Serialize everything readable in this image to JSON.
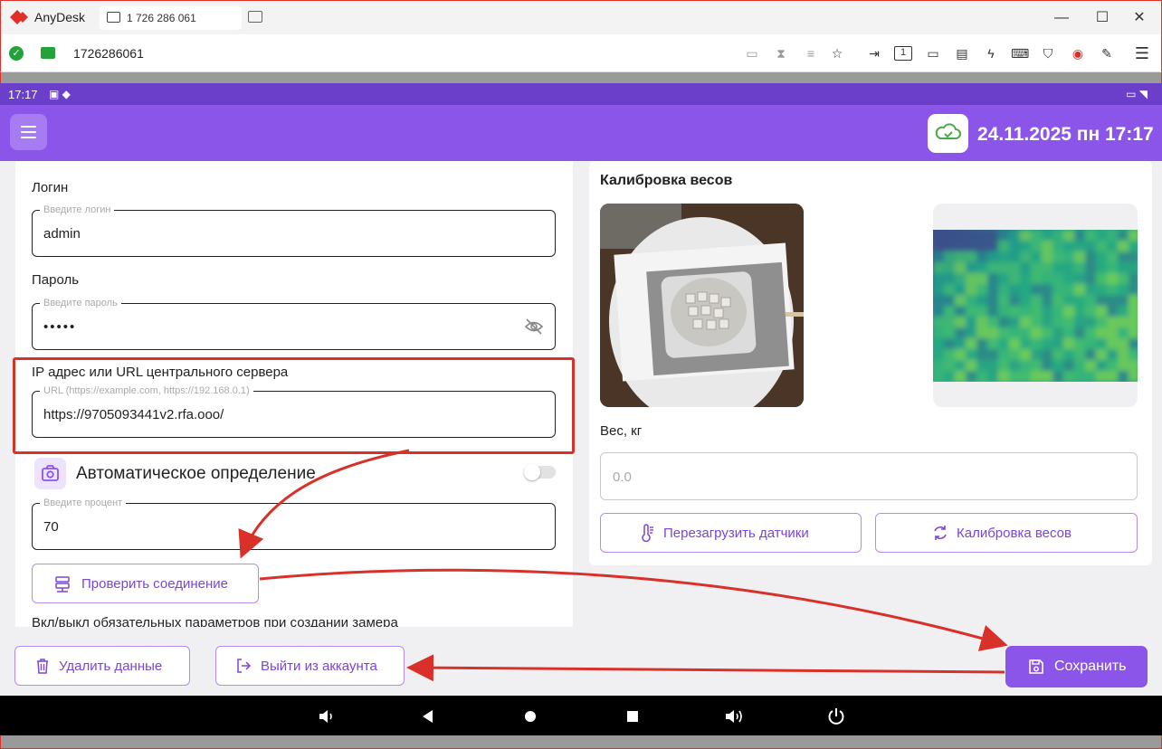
{
  "anydesk": {
    "app_name": "AnyDesk",
    "tab_label": "1 726 286 061",
    "address": "1726286061",
    "window_buttons": {
      "minimize": "—",
      "maximize": "☐",
      "close": "✕"
    }
  },
  "android": {
    "status_time": "17:17",
    "datetime": "24.11.2025 пн 17:17"
  },
  "settings": {
    "login_label": "Логин",
    "login_placeholder": "Введите логин",
    "login_value": "admin",
    "password_label": "Пароль",
    "password_placeholder": "Введите пароль",
    "password_value": "•••••",
    "server_label": "IP адрес или URL центрального сервера",
    "server_placeholder": "URL (https://example.com, https://192.168.0.1)",
    "server_value": "https://9705093441v2.rfa.ooo/",
    "auto_detect_label": "Автоматическое определение",
    "auto_detect_enabled": false,
    "percent_placeholder": "Введите процент",
    "percent_value": "70",
    "check_connection_label": "Проверить соединение",
    "required_params_label": "Вкл/выкл обязательных параметров при создании замера"
  },
  "calibration": {
    "title": "Калибровка весов",
    "weight_label": "Вес, кг",
    "weight_placeholder": "0.0",
    "restart_sensors_label": "Перезагрузить датчики",
    "calibrate_label": "Калибровка весов"
  },
  "footer": {
    "delete_data_label": "Удалить данные",
    "logout_label": "Выйти из аккаунта",
    "save_label": "Сохранить"
  },
  "colors": {
    "accent": "#8c55ea",
    "statusbar": "#6b3fc9",
    "annotation_red": "#d8312a",
    "anydesk_red": "#e0302a",
    "connected_green": "#21a33a"
  },
  "icons": {
    "menu": "hamburger-icon",
    "cloud": "cloud-sync-icon",
    "eye": "eye-off-icon",
    "camera": "camera-icon",
    "server": "server-icon",
    "thermometer": "thermometer-icon",
    "calibrate": "refresh-icon",
    "trash": "trash-icon",
    "logout": "logout-icon",
    "save": "floppy-disk-icon"
  }
}
